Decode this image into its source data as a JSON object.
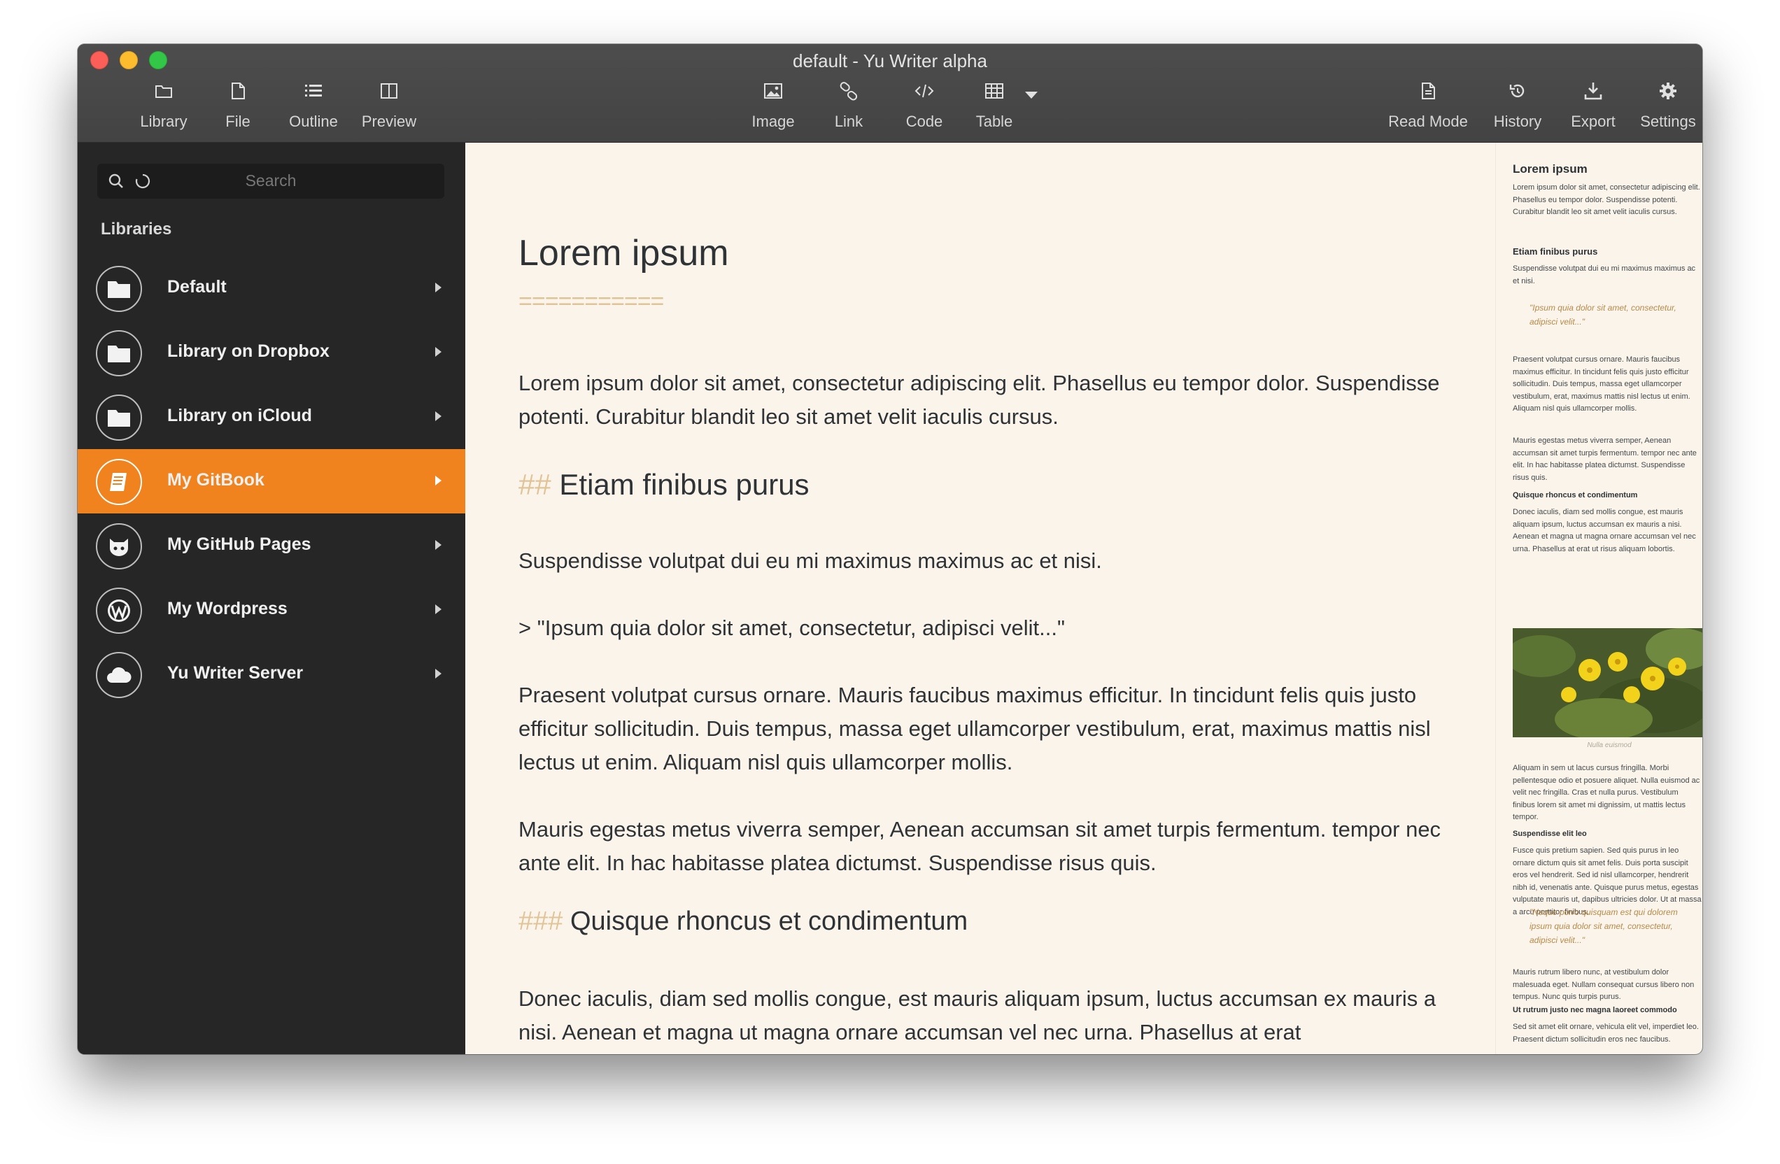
{
  "window": {
    "title": "default - Yu Writer alpha"
  },
  "toolbar": {
    "library": "Library",
    "file": "File",
    "outline": "Outline",
    "preview": "Preview",
    "image": "Image",
    "link": "Link",
    "code": "Code",
    "table": "Table",
    "read_mode": "Read Mode",
    "history": "History",
    "export": "Export",
    "settings": "Settings"
  },
  "sidebar": {
    "search_placeholder": "Search",
    "heading": "Libraries",
    "items": [
      {
        "label": "Default",
        "icon": "folder-icon",
        "active": false
      },
      {
        "label": "Library on Dropbox",
        "icon": "folder-icon",
        "active": false
      },
      {
        "label": "Library on iCloud",
        "icon": "folder-icon",
        "active": false
      },
      {
        "label": "My GitBook",
        "icon": "book-icon",
        "active": true
      },
      {
        "label": "My GitHub Pages",
        "icon": "github-icon",
        "active": false
      },
      {
        "label": "My Wordpress",
        "icon": "wordpress-icon",
        "active": false
      },
      {
        "label": "Yu Writer Server",
        "icon": "cloud-icon",
        "active": false
      }
    ]
  },
  "editor": {
    "h1": "Lorem ipsum",
    "h1_underline": "===========",
    "p1": "Lorem ipsum dolor sit amet, consectetur adipiscing elit. Phasellus eu tempor dolor. Suspendisse potenti. Curabitur blandit leo sit amet velit iaculis cursus.",
    "h2_marker": "##",
    "h2": "Etiam finibus purus",
    "p2": "Suspendisse volutpat dui eu mi maximus maximus ac et nisi.",
    "quote": "> \"Ipsum quia dolor sit amet, consectetur, adipisci velit...\"",
    "p3": "Praesent volutpat cursus ornare. Mauris faucibus maximus efficitur. In tincidunt felis quis justo efficitur sollicitudin. Duis tempus, massa eget ullamcorper vestibulum, erat, maximus mattis nisl lectus ut enim. Aliquam nisl quis ullamcorper mollis.",
    "p4": "Mauris egestas metus viverra semper, Aenean accumsan sit amet turpis fermentum. tempor nec ante elit. In hac habitasse platea dictumst. Suspendisse risus quis.",
    "h3_marker": "###",
    "h3": "Quisque rhoncus et condimentum",
    "p5": "Donec iaculis, diam sed mollis congue, est mauris aliquam ipsum, luctus accumsan ex mauris a nisi. Aenean et magna ut magna ornare accumsan vel nec urna. Phasellus at erat"
  },
  "preview": {
    "h1": "Lorem ipsum",
    "p1": "Lorem ipsum dolor sit amet, consectetur adipiscing elit. Phasellus eu tempor dolor. Suspendisse potenti. Curabitur blandit leo sit amet velit iaculis cursus.",
    "h2": "Etiam finibus purus",
    "p2": "Suspendisse volutpat dui eu mi maximus maximus ac et nisi.",
    "quote1": "\"Ipsum quia dolor sit amet, consectetur, adipisci velit...\"",
    "p3": "Praesent volutpat cursus ornare. Mauris faucibus maximus efficitur. In tincidunt felis quis justo efficitur sollicitudin. Duis tempus, massa eget ullamcorper vestibulum, erat, maximus mattis nisl lectus ut enim. Aliquam nisl quis ullamcorper mollis.",
    "p4": "Mauris egestas metus viverra semper, Aenean accumsan sit amet turpis fermentum. tempor nec ante elit. In hac habitasse platea dictumst. Suspendisse risus quis.",
    "h3": "Quisque rhoncus et condimentum",
    "p5": "Donec iaculis, diam sed mollis congue, est mauris aliquam ipsum, luctus accumsan ex mauris a nisi. Aenean et magna ut magna ornare accumsan vel nec urna. Phasellus at erat ut risus aliquam lobortis.",
    "image_caption": "Nulla euismod",
    "p6": "Aliquam in sem ut lacus cursus fringilla. Morbi pellentesque odio et posuere aliquet. Nulla euismod ac velit nec fringilla. Cras et nulla purus. Vestibulum finibus lorem sit amet mi dignissim, ut mattis lectus tempor.",
    "h4": "Suspendisse elit leo",
    "p7": "Fusce quis pretium sapien. Sed quis purus in leo ornare dictum quis sit amet felis. Duis porta suscipit eros vel hendrerit. Sed id nisl ullamcorper, hendrerit nibh id, venenatis ante. Quisque purus metus, egestas vulputate mauris ut, dapibus ultricies dolor. Ut at massa a arcu porttitor finibus.",
    "quote2": "\"Neque porro quisquam est qui dolorem ipsum quia dolor sit amet, consectetur, adipisci velit...\"",
    "p8": "Mauris rutrum libero nunc, at vestibulum dolor malesuada eget. Nullam consequat cursus libero non tempus. Nunc quis turpis purus.",
    "h5": "Ut rutrum justo nec magna laoreet commodo",
    "p9": "Sed sit amet elit ornare, vehicula elit vel, imperdiet leo. Praesent dictum sollicitudin eros nec faucibus."
  },
  "colors": {
    "accent": "#f0831e",
    "sidebar_bg": "#262626",
    "editor_bg": "#faf4ea",
    "markdown_marker": "#e0c497"
  }
}
